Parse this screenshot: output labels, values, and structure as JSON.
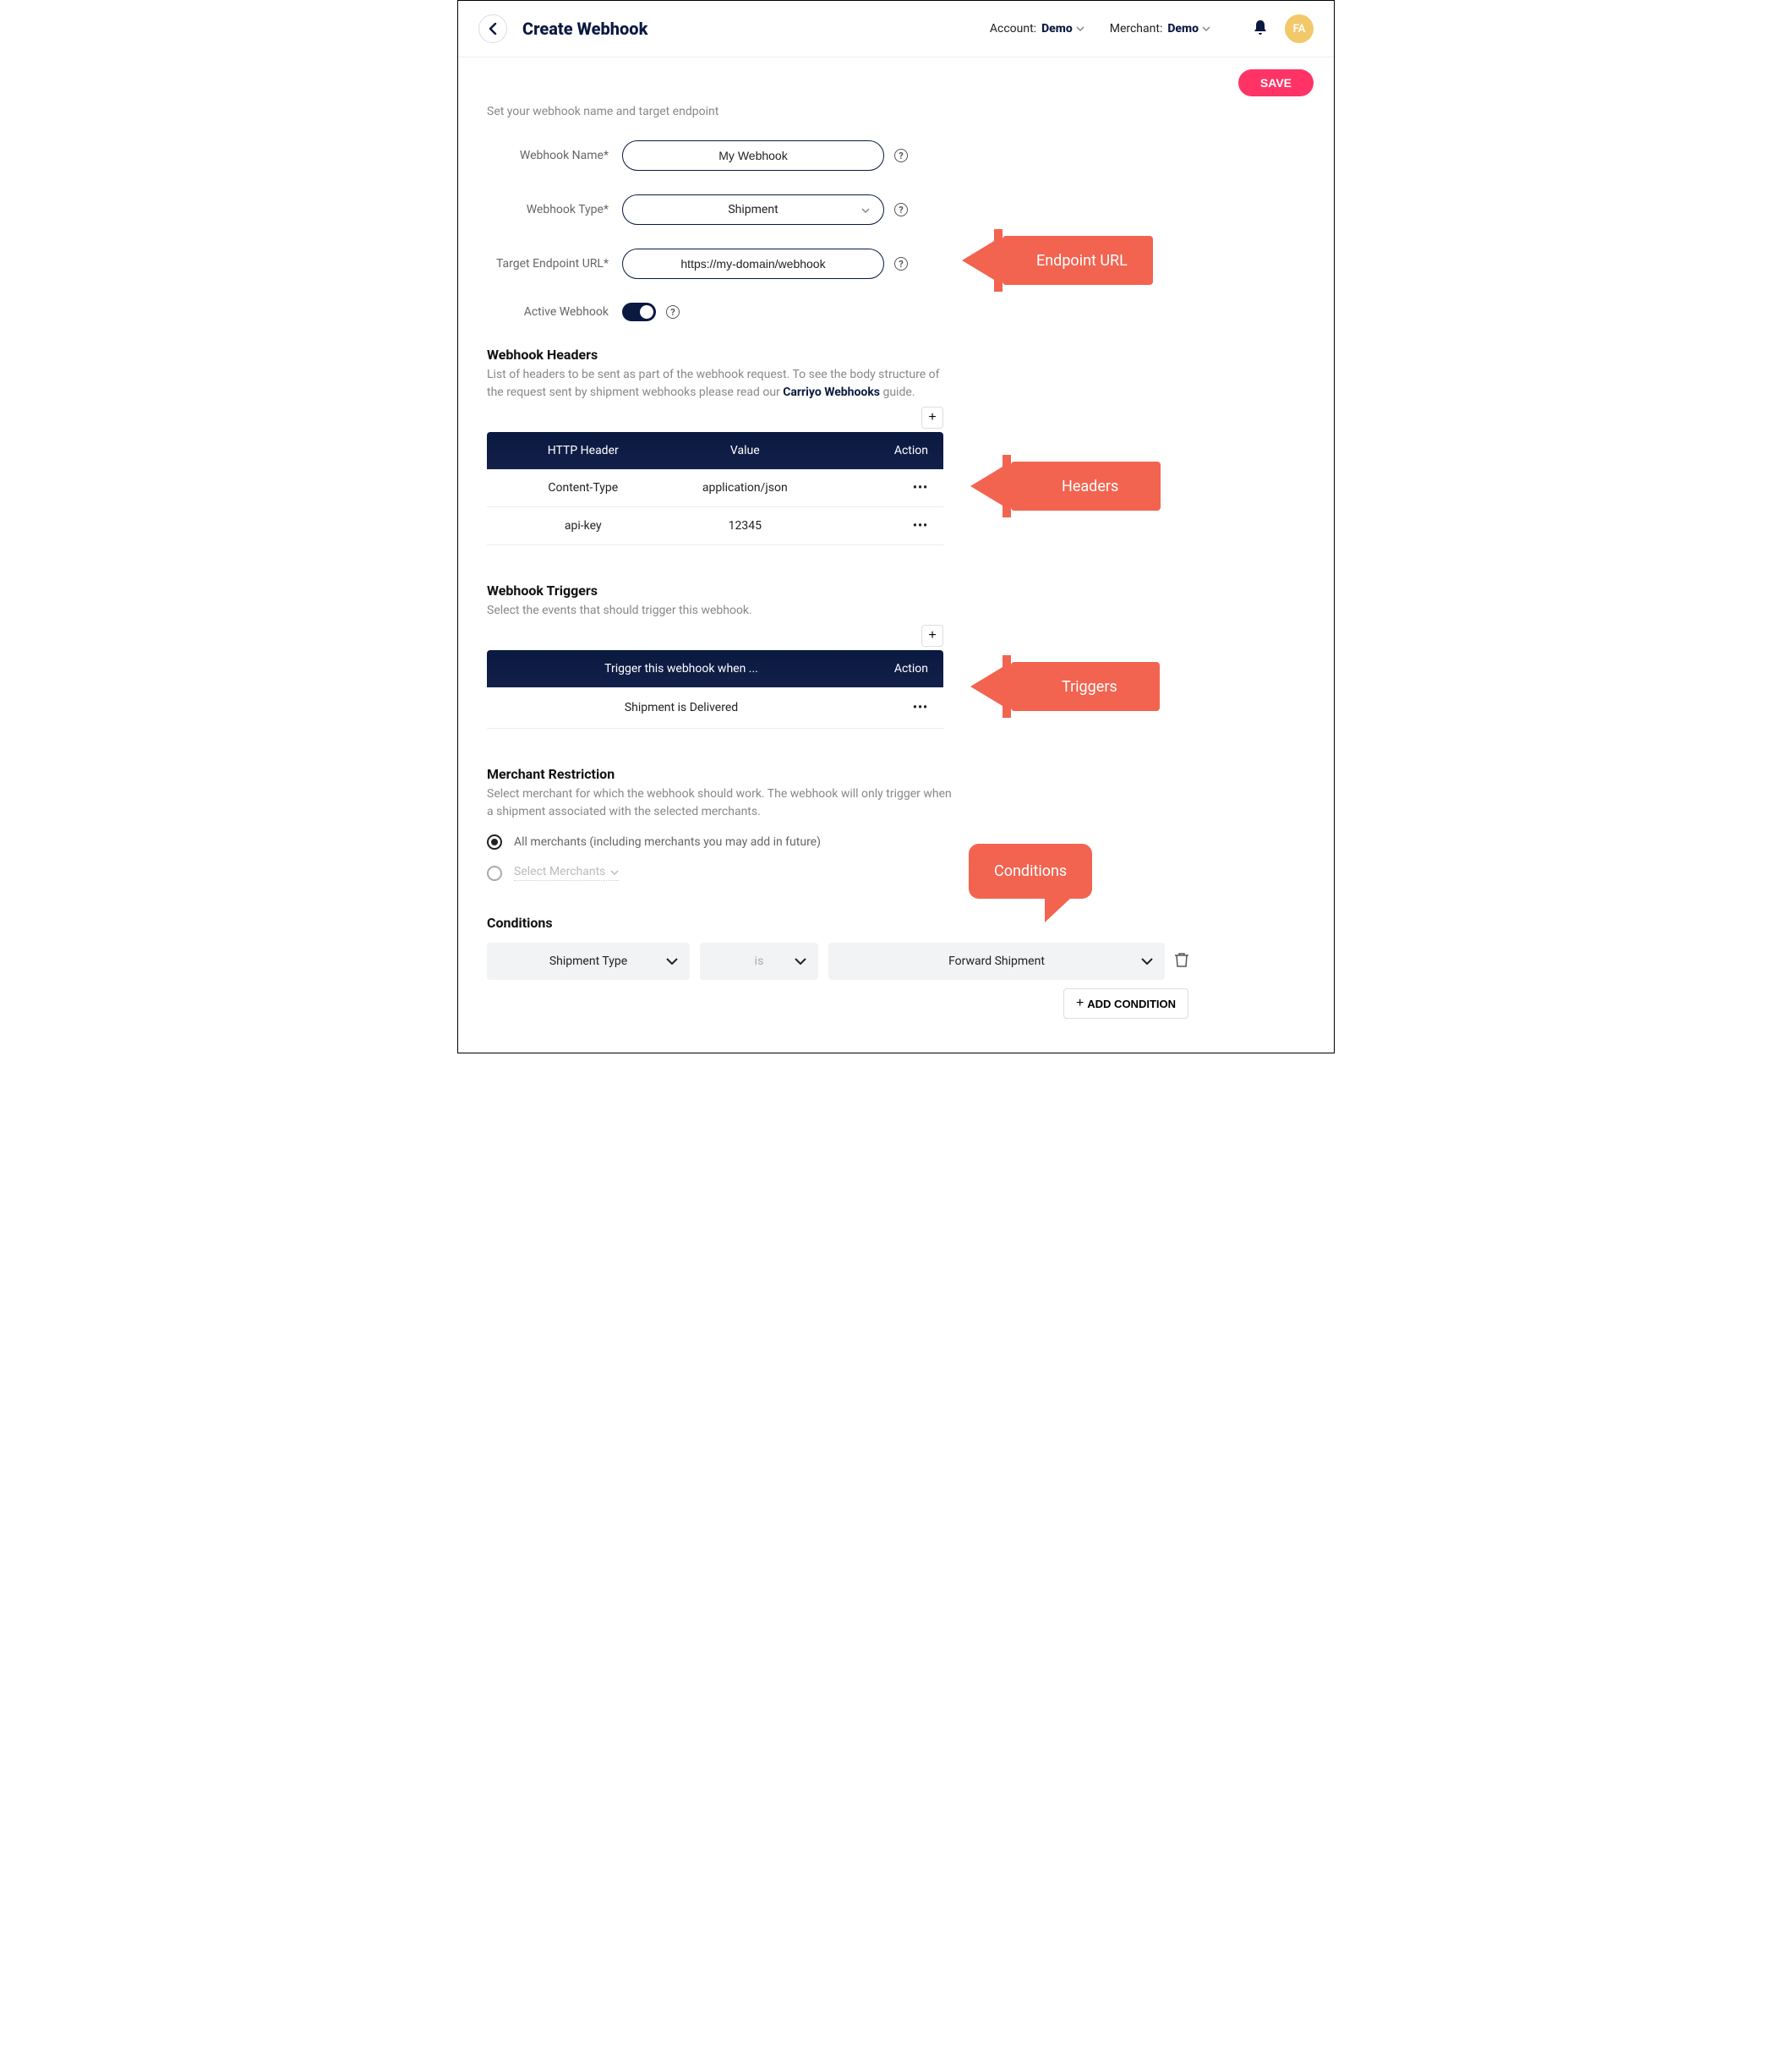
{
  "topbar": {
    "page_title": "Create Webhook",
    "account_label": "Account:",
    "account_value": "Demo",
    "merchant_label": "Merchant:",
    "merchant_value": "Demo",
    "avatar": "FA"
  },
  "save_label": "SAVE",
  "form": {
    "intro": "Set your webhook name and target endpoint",
    "name_label": "Webhook Name*",
    "name_value": "My Webhook",
    "type_label": "Webhook Type*",
    "type_value": "Shipment",
    "url_label": "Target Endpoint URL*",
    "url_value": "https://my-domain/webhook",
    "active_label": "Active Webhook"
  },
  "headers": {
    "title": "Webhook Headers",
    "desc_pre": "List of headers to be sent as part of the webhook request. To see the body structure of the request sent by shipment webhooks please read our ",
    "desc_link": "Carriyo Webhooks",
    "desc_post": " guide.",
    "col_header": "HTTP Header",
    "col_value": "Value",
    "col_action": "Action",
    "rows": [
      {
        "header": "Content-Type",
        "value": "application/json"
      },
      {
        "header": "api-key",
        "value": "12345"
      }
    ]
  },
  "triggers": {
    "title": "Webhook Triggers",
    "desc": "Select the events that should trigger this webhook.",
    "col_event": "Trigger this webhook when ...",
    "col_action": "Action",
    "rows": [
      {
        "event": "Shipment is Delivered"
      }
    ]
  },
  "merchant": {
    "title": "Merchant Restriction",
    "desc": "Select merchant for which the webhook should work. The webhook will only trigger when a shipment associated with the selected merchants.",
    "opt_all": "All merchants (including merchants you may add in future)",
    "opt_select": "Select Merchants"
  },
  "conditions": {
    "title": "Conditions",
    "field": "Shipment Type",
    "operator": "is",
    "value": "Forward Shipment",
    "add_label": "ADD CONDITION"
  },
  "callouts": {
    "endpoint": "Endpoint URL",
    "headers": "Headers",
    "triggers": "Triggers",
    "conditions": "Conditions"
  }
}
